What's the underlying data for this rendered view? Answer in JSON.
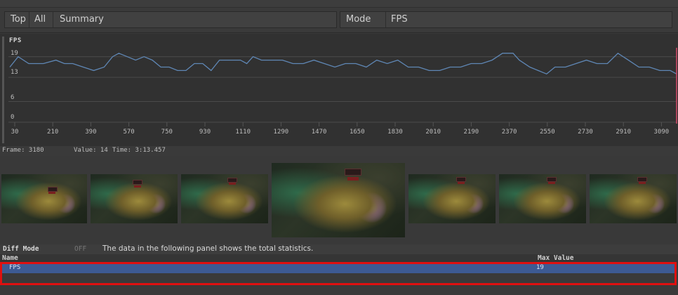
{
  "toolbar": {
    "top_label": "Top",
    "all_label": "All",
    "summary_label": "Summary",
    "mode_label": "Mode",
    "mode_value": "FPS"
  },
  "graph": {
    "title": "FPS",
    "yticks": [
      "19",
      "13",
      "6",
      "0"
    ],
    "xticks": [
      "30",
      "210",
      "390",
      "570",
      "750",
      "930",
      "1110",
      "1290",
      "1470",
      "1650",
      "1830",
      "2010",
      "2190",
      "2370",
      "2550",
      "2730",
      "2910",
      "3090"
    ],
    "line_color": "#5f87b5",
    "grid_color": "#4a4a4a"
  },
  "chart_data": {
    "type": "line",
    "title": "FPS",
    "xlabel": "",
    "ylabel": "",
    "xlim": [
      0,
      3180
    ],
    "ylim": [
      0,
      22
    ],
    "grid": true,
    "x": [
      0,
      40,
      90,
      160,
      220,
      260,
      300,
      350,
      400,
      450,
      490,
      520,
      560,
      600,
      640,
      680,
      720,
      760,
      800,
      840,
      880,
      920,
      960,
      1000,
      1050,
      1100,
      1130,
      1160,
      1200,
      1250,
      1300,
      1350,
      1400,
      1450,
      1500,
      1550,
      1600,
      1650,
      1700,
      1750,
      1800,
      1850,
      1900,
      1950,
      2000,
      2050,
      2100,
      2150,
      2200,
      2250,
      2300,
      2350,
      2400,
      2430,
      2480,
      2520,
      2560,
      2600,
      2650,
      2700,
      2750,
      2800,
      2850,
      2900,
      2950,
      3000,
      3050,
      3100,
      3150,
      3180
    ],
    "series": [
      {
        "values": [
          16,
          19,
          17,
          17,
          18,
          17,
          17,
          16,
          15,
          16,
          19,
          20,
          19,
          18,
          19,
          18,
          16,
          16,
          15,
          15,
          17,
          17,
          15,
          18,
          18,
          18,
          17,
          19,
          18,
          18,
          18,
          17,
          17,
          18,
          17,
          16,
          17,
          17,
          16,
          18,
          17,
          18,
          16,
          16,
          15,
          15,
          16,
          16,
          17,
          17,
          18,
          20,
          20,
          18,
          16,
          15,
          14,
          16,
          16,
          17,
          18,
          17,
          17,
          20,
          18,
          16,
          16,
          15,
          15,
          14
        ]
      }
    ]
  },
  "status": {
    "frame": "Frame: 3180",
    "value": "Value: 14",
    "time": "Time: 3:13.457"
  },
  "diff": {
    "label": "Diff Mode",
    "state": "OFF",
    "description": "The data in the following panel shows the total statistics."
  },
  "table": {
    "col_name": "Name",
    "col_max": "Max Value",
    "rows": [
      {
        "name": "FPS",
        "max": "19"
      }
    ]
  },
  "highlight_color": "#e01010"
}
